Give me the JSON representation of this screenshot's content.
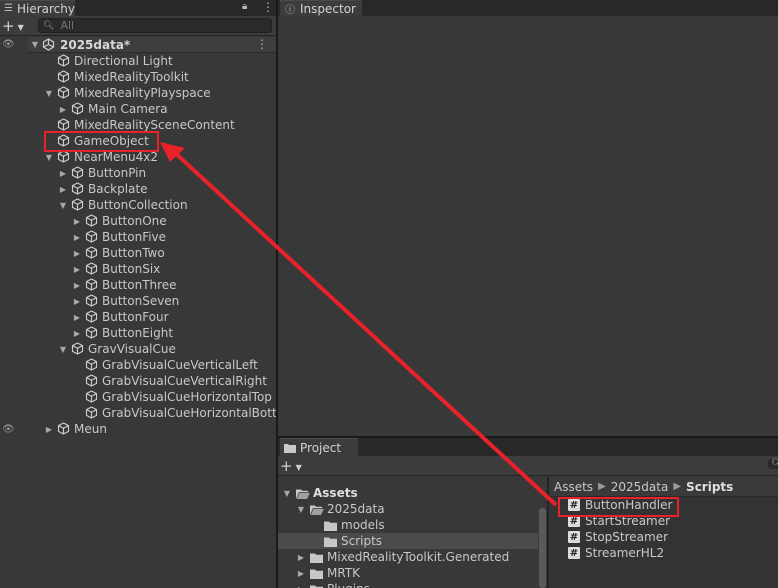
{
  "hierarchy": {
    "tab_label": "Hierarchy",
    "search_placeholder": "All",
    "scene_name": "2025data*",
    "rows": [
      {
        "label": "Directional Light"
      },
      {
        "label": "MixedRealityToolkit"
      },
      {
        "label": "MixedRealityPlayspace"
      },
      {
        "label": "Main Camera"
      },
      {
        "label": "MixedRealitySceneContent"
      },
      {
        "label": "GameObject"
      },
      {
        "label": "NearMenu4x2"
      },
      {
        "label": "ButtonPin"
      },
      {
        "label": "Backplate"
      },
      {
        "label": "ButtonCollection"
      },
      {
        "label": "ButtonOne"
      },
      {
        "label": "ButtonFive"
      },
      {
        "label": "ButtonTwo"
      },
      {
        "label": "ButtonSix"
      },
      {
        "label": "ButtonThree"
      },
      {
        "label": "ButtonSeven"
      },
      {
        "label": "ButtonFour"
      },
      {
        "label": "ButtonEight"
      },
      {
        "label": "GravVisualCue"
      },
      {
        "label": "GrabVisualCueVerticalLeft"
      },
      {
        "label": "GrabVisualCueVerticalRight"
      },
      {
        "label": "GrabVisualCueHorizontalTop"
      },
      {
        "label": "GrabVisualCueHorizontalBotto"
      },
      {
        "label": "Meun"
      }
    ]
  },
  "inspector": {
    "tab_label": "Inspector"
  },
  "project": {
    "tab_label": "Project",
    "tree": [
      {
        "label": "Assets"
      },
      {
        "label": "2025data"
      },
      {
        "label": "models"
      },
      {
        "label": "Scripts"
      },
      {
        "label": "MixedRealityToolkit.Generated"
      },
      {
        "label": "MRTK"
      },
      {
        "label": "Plugins"
      }
    ],
    "breadcrumb": [
      "Assets",
      "2025data",
      "Scripts"
    ],
    "files": [
      {
        "label": "ButtonHandler"
      },
      {
        "label": "StartStreamer"
      },
      {
        "label": "StopStreamer"
      },
      {
        "label": "StreamerHL2"
      }
    ]
  },
  "colors": {
    "annotation_red": "#e8222a",
    "panel_bg": "#383838"
  }
}
